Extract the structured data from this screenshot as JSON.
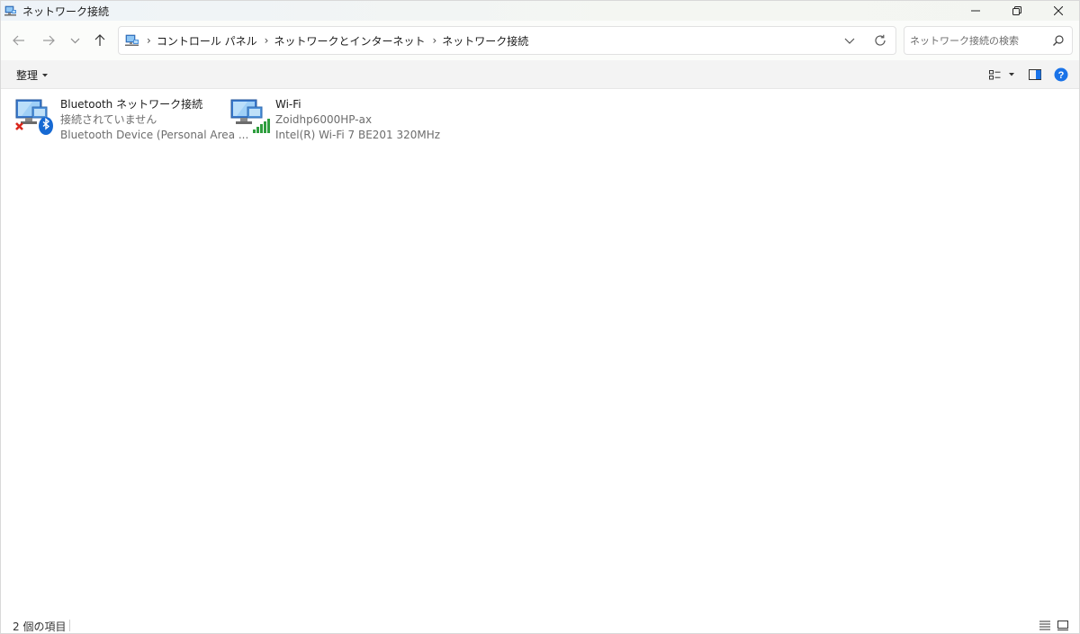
{
  "window": {
    "title": "ネットワーク接続",
    "controls": {
      "minimize": "minimize-icon",
      "restore": "restore-icon",
      "close": "close-icon"
    }
  },
  "nav": {
    "back_icon": "arrow-left-icon",
    "forward_icon": "arrow-right-icon",
    "recent_icon": "chevron-down-icon",
    "up_icon": "arrow-up-icon"
  },
  "address": {
    "icon": "network-folder-icon",
    "breadcrumbs": [
      "コントロール パネル",
      "ネットワークとインターネット",
      "ネットワーク接続"
    ],
    "separator": "›"
  },
  "search": {
    "placeholder": "ネットワーク接続の検索",
    "value": ""
  },
  "command_bar": {
    "organize_label": "整理"
  },
  "items": [
    {
      "name": "Bluetooth ネットワーク接続",
      "status": "接続されていません",
      "device": "Bluetooth Device (Personal Area ...",
      "icon": "bluetooth-network-adapter-icon",
      "state": "disconnected"
    },
    {
      "name": "Wi-Fi",
      "status": "Zoidhp6000HP-ax",
      "device": "Intel(R) Wi-Fi 7 BE201 320MHz",
      "icon": "wifi-network-adapter-icon",
      "state": "connected"
    }
  ],
  "statusbar": {
    "item_count": "2 個の項目"
  },
  "colors": {
    "accent": "#0067c0",
    "help_blue": "#1a73e8",
    "error_red": "#d9261c",
    "signal_green": "#2e9e3e"
  }
}
